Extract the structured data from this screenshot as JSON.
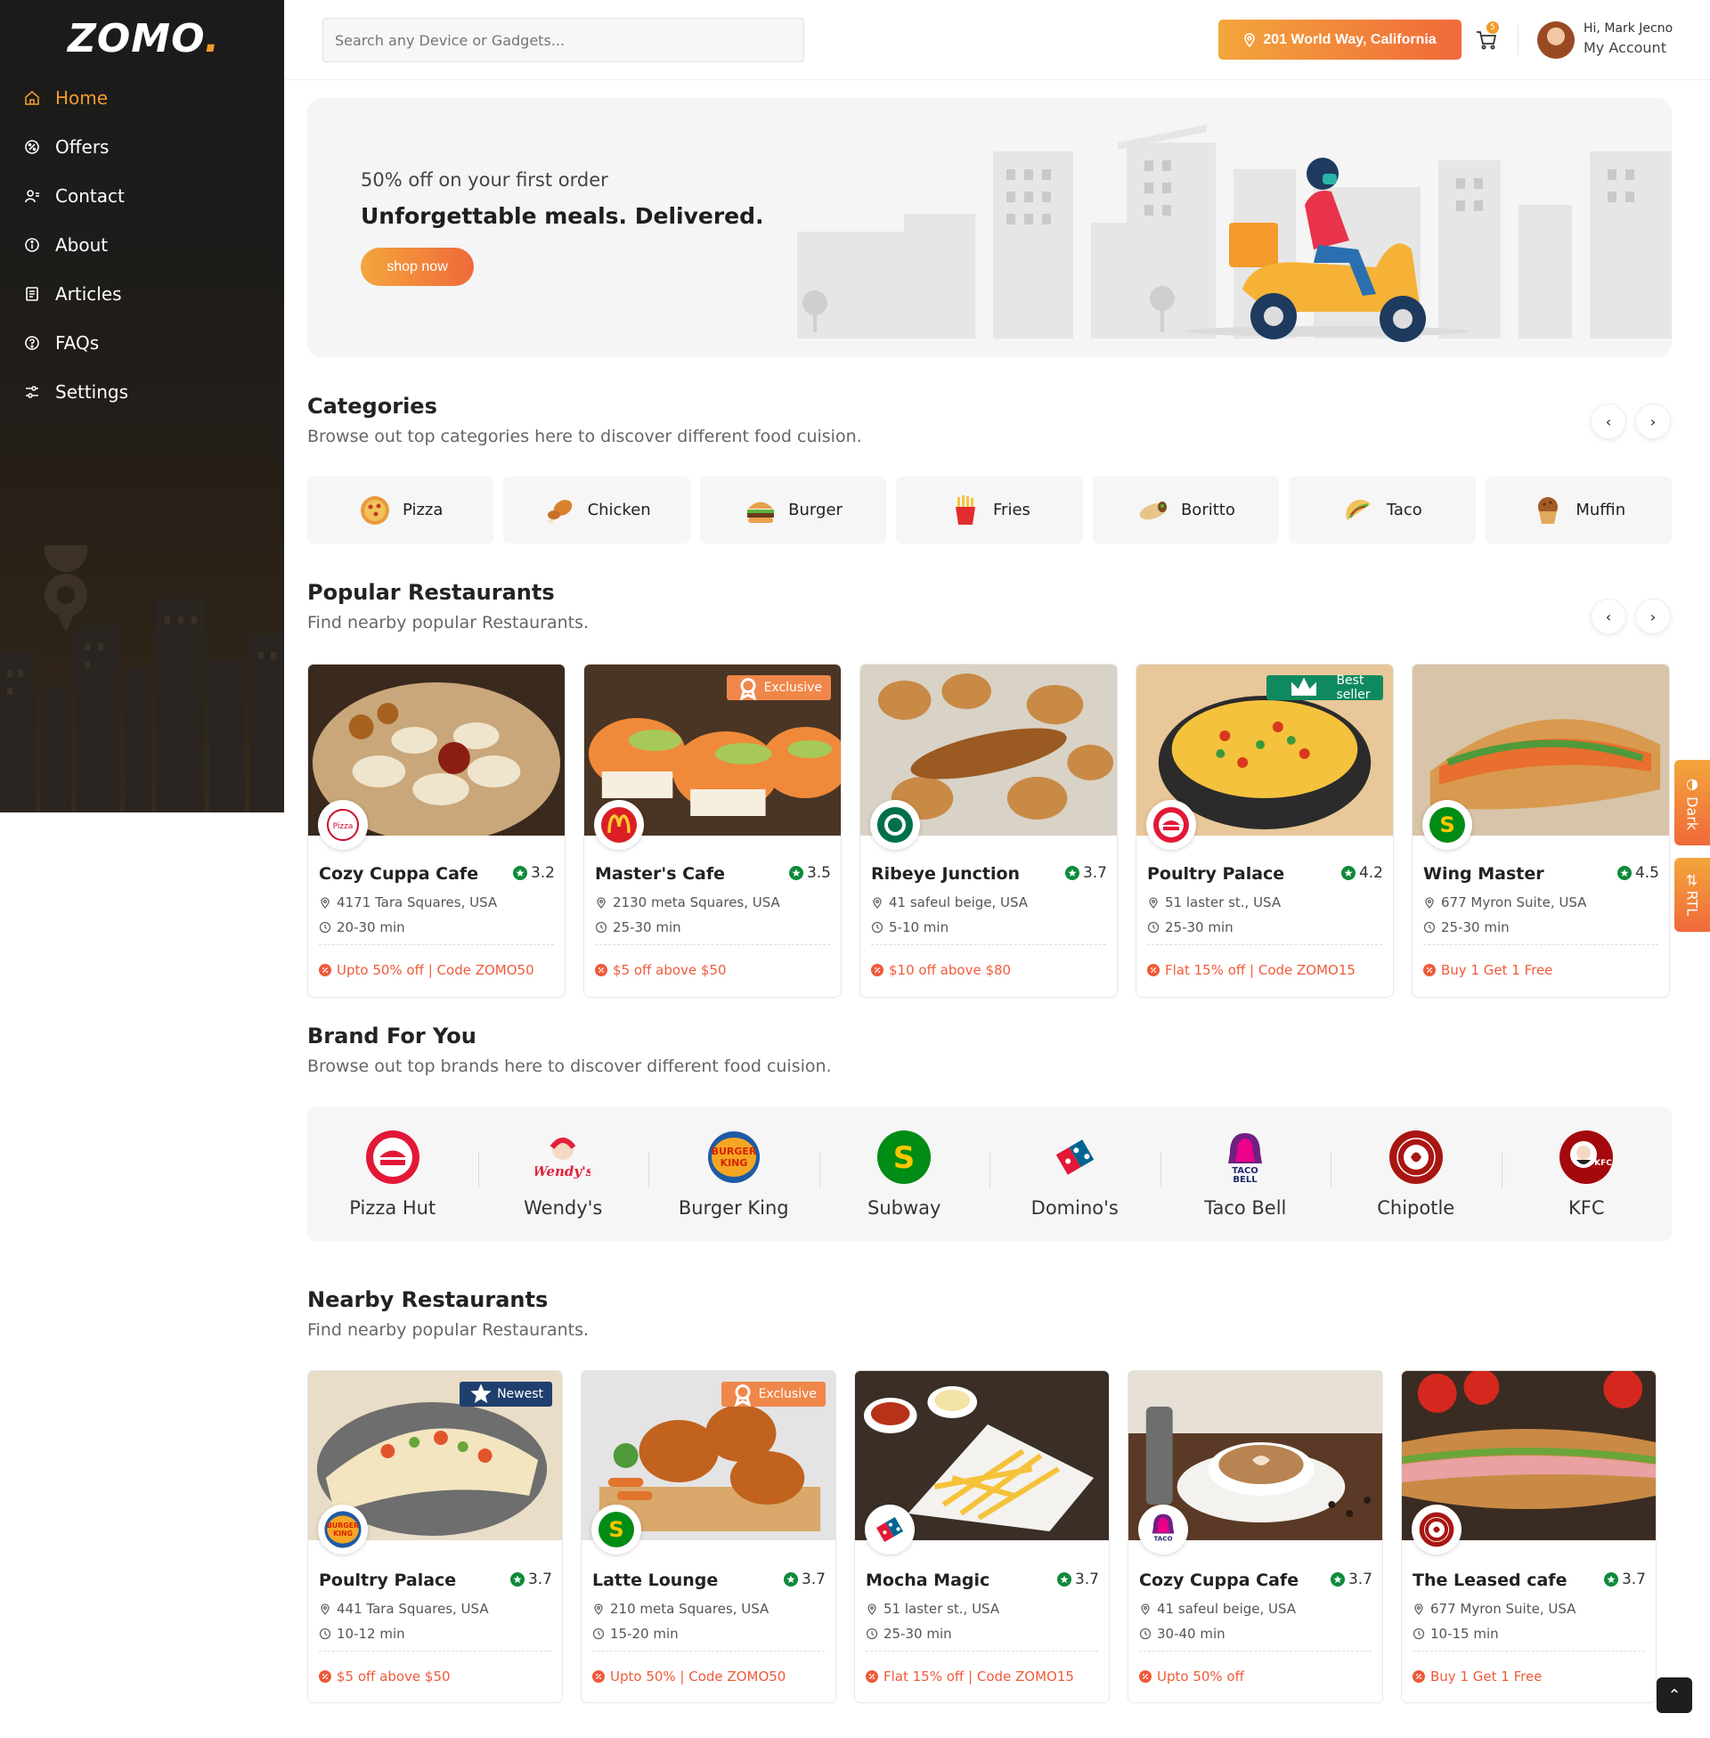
{
  "app": {
    "logo_text": "ZOMO",
    "logo_dot": "."
  },
  "sidebar": {
    "items": [
      {
        "label": "Home",
        "icon": "home-icon",
        "active": true
      },
      {
        "label": "Offers",
        "icon": "offer-icon",
        "active": false
      },
      {
        "label": "Contact",
        "icon": "contact-icon",
        "active": false
      },
      {
        "label": "About",
        "icon": "info-icon",
        "active": false
      },
      {
        "label": "Articles",
        "icon": "article-icon",
        "active": false
      },
      {
        "label": "FAQs",
        "icon": "question-icon",
        "active": false
      },
      {
        "label": "Settings",
        "icon": "settings-icon",
        "active": false
      }
    ]
  },
  "header": {
    "search_placeholder": "Search any Device or Gadgets...",
    "location": "201 World Way, California",
    "cart_count": "5",
    "greeting": "Hi, Mark Jecno",
    "account_label": "My Account"
  },
  "hero": {
    "subtitle": "50% off on your first order",
    "title": "Unforgettable meals. Delivered.",
    "button": "shop now"
  },
  "categories": {
    "title": "Categories",
    "subtitle": "Browse out top categories here to discover different food cuision.",
    "items": [
      {
        "label": "Pizza",
        "icon": "pizza-icon"
      },
      {
        "label": "Chicken",
        "icon": "chicken-icon"
      },
      {
        "label": "Burger",
        "icon": "burger-icon"
      },
      {
        "label": "Fries",
        "icon": "fries-icon"
      },
      {
        "label": "Boritto",
        "icon": "burrito-icon"
      },
      {
        "label": "Taco",
        "icon": "taco-icon"
      },
      {
        "label": "Muffin",
        "icon": "muffin-icon"
      }
    ]
  },
  "popular": {
    "title": "Popular Restaurants",
    "subtitle": "Find nearby popular Restaurants.",
    "items": [
      {
        "name": "Cozy Cuppa Cafe",
        "rating": "3.2",
        "address": "4171 Tara Squares, USA",
        "time": "20-30 min",
        "offer": "Upto 50% off | Code ZOMO50",
        "badge": "",
        "brand": "la-pinoz-logo",
        "image": "dumplings"
      },
      {
        "name": "Master's Cafe",
        "rating": "3.5",
        "address": "2130 meta Squares, USA",
        "time": "25-30 min",
        "offer": "$5 off above $50",
        "badge": "Exclusive",
        "brand": "mcdonalds-logo",
        "image": "sushi"
      },
      {
        "name": "Ribeye Junction",
        "rating": "3.7",
        "address": "41 safeul beige, USA",
        "time": "5-10 min",
        "offer": "$10 off above $80",
        "badge": "",
        "brand": "starbucks-logo",
        "image": "pastries"
      },
      {
        "name": "Poultry Palace",
        "rating": "4.2",
        "address": "51 laster st., USA",
        "time": "25-30 min",
        "offer": "Flat 15% off | Code ZOMO15",
        "badge": "Best seller",
        "brand": "pizza-hut-logo",
        "image": "nachos"
      },
      {
        "name": "Wing Master",
        "rating": "4.5",
        "address": "677 Myron Suite, USA",
        "time": "25-30 min",
        "offer": "Buy 1 Get 1 Free",
        "badge": "",
        "brand": "subway-logo",
        "image": "sandwich"
      }
    ]
  },
  "brands": {
    "title": "Brand For You",
    "subtitle": "Browse out top brands here to discover different food cuision.",
    "items": [
      {
        "name": "Pizza Hut",
        "icon": "pizza-hut-logo"
      },
      {
        "name": "Wendy's",
        "icon": "wendys-logo"
      },
      {
        "name": "Burger King",
        "icon": "burger-king-logo"
      },
      {
        "name": "Subway",
        "icon": "subway-logo"
      },
      {
        "name": "Domino's",
        "icon": "dominos-logo"
      },
      {
        "name": "Taco Bell",
        "icon": "taco-bell-logo"
      },
      {
        "name": "Chipotle",
        "icon": "chipotle-logo"
      },
      {
        "name": "KFC",
        "icon": "kfc-logo"
      }
    ]
  },
  "nearby": {
    "title": "Nearby Restaurants",
    "subtitle": "Find nearby popular Restaurants.",
    "items": [
      {
        "name": "Poultry Palace",
        "rating": "3.7",
        "address": "441 Tara Squares, USA",
        "time": "10-12 min",
        "offer": "$5 off above $50",
        "badge": "Newest",
        "brand": "burger-king-logo",
        "image": "tacos"
      },
      {
        "name": "Latte Lounge",
        "rating": "3.7",
        "address": "210 meta Squares, USA",
        "time": "15-20 min",
        "offer": "Upto 50% | Code ZOMO50",
        "badge": "Exclusive",
        "brand": "subway-logo",
        "image": "fried-chicken"
      },
      {
        "name": "Mocha Magic",
        "rating": "3.7",
        "address": "51 laster st., USA",
        "time": "25-30 min",
        "offer": "Flat 15% off | Code ZOMO15",
        "badge": "",
        "brand": "dominos-logo",
        "image": "fries"
      },
      {
        "name": "Cozy Cuppa Cafe",
        "rating": "3.7",
        "address": "41 safeul beige, USA",
        "time": "30-40 min",
        "offer": "Upto 50% off",
        "badge": "",
        "brand": "taco-bell-logo",
        "image": "coffee"
      },
      {
        "name": "The Leased cafe",
        "rating": "3.7",
        "address": "677 Myron Suite, USA",
        "time": "10-15 min",
        "offer": "Buy 1 Get 1 Free",
        "badge": "",
        "brand": "chipotle-logo",
        "image": "baguette"
      }
    ]
  },
  "side_tabs": {
    "dark": "Dark",
    "rtl": "RTL"
  },
  "colors": {
    "accent": "#f39a2b",
    "accent_end": "#f0693a",
    "offer": "#f05a3a",
    "rating_star": "#0f8a3a"
  }
}
